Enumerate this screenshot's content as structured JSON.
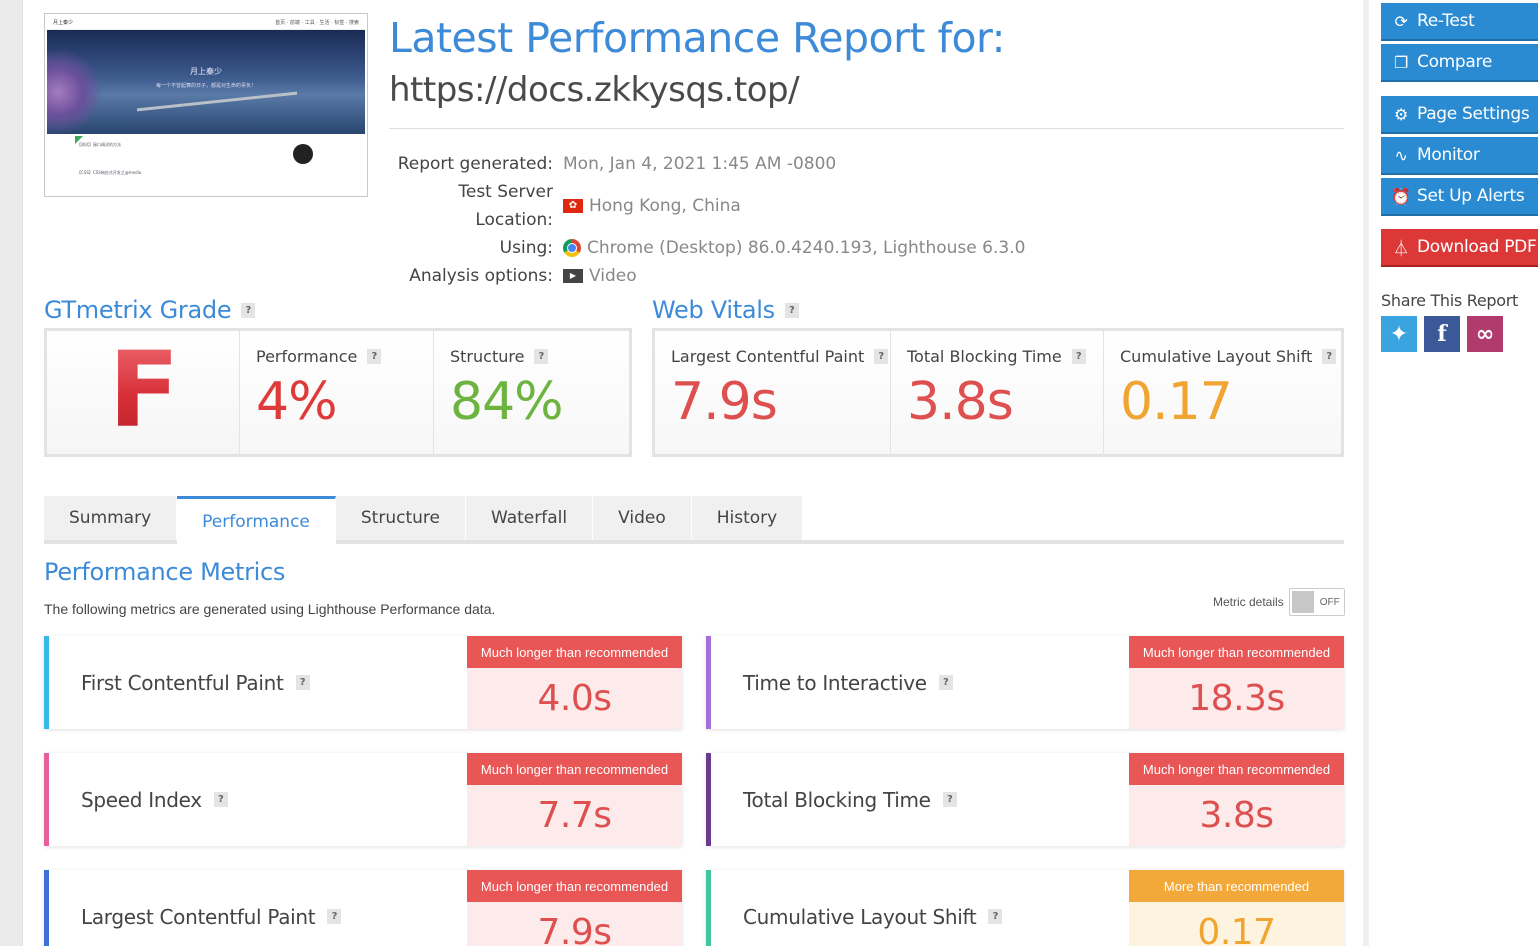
{
  "header": {
    "title": "Latest Performance Report for:",
    "url": "https://docs.zkkysqs.top/"
  },
  "thumbnail": {
    "site_name": "月上秦少",
    "nav": "首页 · 前端 · 工具 · 生活 · 标签 · 搜索",
    "hero_title": "月上秦少",
    "hero_subtitle": "每一个不曾起舞的日子，都是对生命的辜负！",
    "post1": "【测试】接口调试的方法",
    "post2": "【CSS】CSS响应式开发之@media"
  },
  "report_info": [
    {
      "label": "Report generated:",
      "value": "Mon, Jan 4, 2021 1:45 AM -0800",
      "icon": ""
    },
    {
      "label": "Test Server Location:",
      "value": "Hong Kong, China",
      "icon": "hk-flag-icon"
    },
    {
      "label": "Using:",
      "value": "Chrome (Desktop) 86.0.4240.193, Lighthouse 6.3.0",
      "icon": "chrome-icon"
    },
    {
      "label": "Analysis options:",
      "value": "Video",
      "icon": "video-icon"
    }
  ],
  "grade": {
    "heading": "GTmetrix Grade",
    "help": "?",
    "letter": "F",
    "performance_label": "Performance",
    "performance_value": "4%",
    "structure_label": "Structure",
    "structure_value": "84%"
  },
  "web_vitals": {
    "heading": "Web Vitals",
    "help": "?",
    "lcp_label": "Largest Contentful Paint",
    "lcp_value": "7.9s",
    "tbt_label": "Total Blocking Time",
    "tbt_value": "3.8s",
    "cls_label": "Cumulative Layout Shift",
    "cls_value": "0.17"
  },
  "tabs": [
    "Summary",
    "Performance",
    "Structure",
    "Waterfall",
    "Video",
    "History"
  ],
  "active_tab": "Performance",
  "metrics_section": {
    "title": "Performance Metrics",
    "description": "The following metrics are generated using Lighthouse Performance data.",
    "toggle_label": "Metric details",
    "toggle_state": "OFF"
  },
  "metrics": [
    {
      "name": "First Contentful Paint",
      "badge": "Much longer than recommended",
      "value": "4.0s",
      "status": "red",
      "accent": "#35b9e9"
    },
    {
      "name": "Time to Interactive",
      "badge": "Much longer than recommended",
      "value": "18.3s",
      "status": "red",
      "accent": "#a66ed8"
    },
    {
      "name": "Speed Index",
      "badge": "Much longer than recommended",
      "value": "7.7s",
      "status": "red",
      "accent": "#e5609d"
    },
    {
      "name": "Total Blocking Time",
      "badge": "Much longer than recommended",
      "value": "3.8s",
      "status": "red",
      "accent": "#6a3b8c"
    },
    {
      "name": "Largest Contentful Paint",
      "badge": "Much longer than recommended",
      "value": "7.9s",
      "status": "red",
      "accent": "#3f6fd8"
    },
    {
      "name": "Cumulative Layout Shift",
      "badge": "More than recommended",
      "value": "0.17",
      "status": "orange",
      "accent": "#3fc7a0"
    }
  ],
  "sidebar": {
    "retest": "Re-Test",
    "compare": "Compare",
    "page_settings": "Page Settings",
    "monitor": "Monitor",
    "alerts": "Set Up Alerts",
    "pdf": "Download PDF",
    "share_label": "Share This Report"
  },
  "colors": {
    "accent": "#3d8bd8",
    "button_blue": "#2a8bd3",
    "button_red": "#dc3838",
    "grade_red": "#d9383f",
    "bad_red": "#de4f4f",
    "good_green": "#6cb33f",
    "warn_orange": "#f0a432"
  }
}
